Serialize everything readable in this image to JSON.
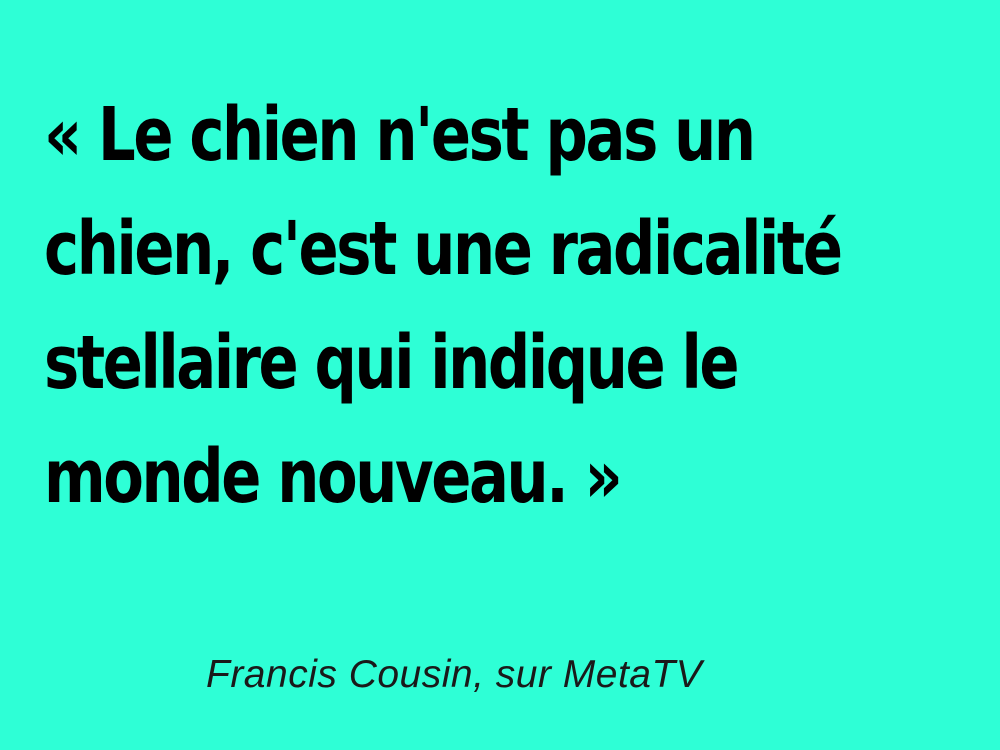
{
  "background_color": "#2effd6",
  "text_color": "#000000",
  "quote": {
    "lines": [
      "« Le chien n'est pas un",
      "chien, c'est une radicalité",
      "stellaire qui indique le",
      "monde nouveau. »"
    ]
  },
  "attribution": "Francis Cousin, sur MetaTV"
}
